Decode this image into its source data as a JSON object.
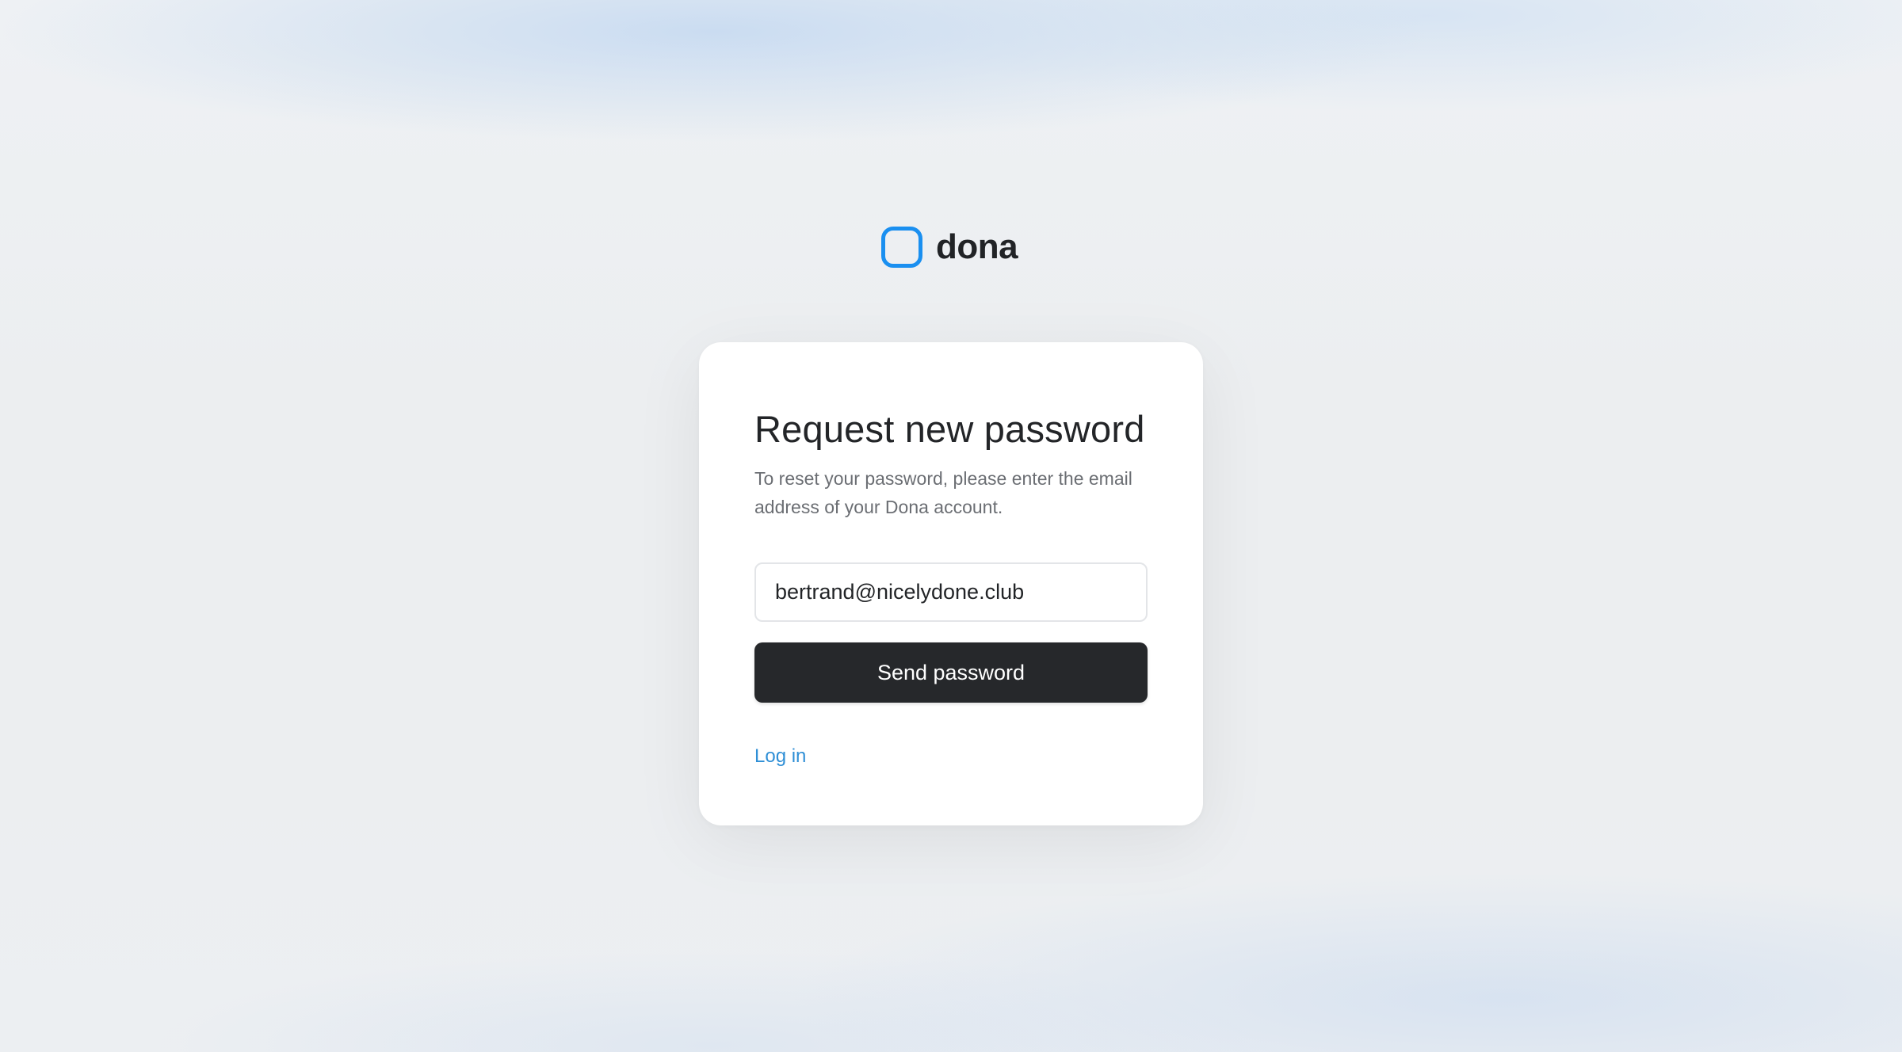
{
  "brand": {
    "name": "dona",
    "icon": "rounded-square-logo-icon",
    "icon_color": "#1a8ff0"
  },
  "card": {
    "title": "Request new password",
    "description": "To reset your password, please enter the email address of your Dona account.",
    "email": {
      "value": "bertrand@nicelydone.club",
      "placeholder": ""
    },
    "submit_label": "Send password",
    "login_link_label": "Log in"
  },
  "colors": {
    "accent": "#1a8ff0",
    "link": "#2f8fd6",
    "button_bg": "#26282b",
    "page_bg": "#eceef0"
  }
}
